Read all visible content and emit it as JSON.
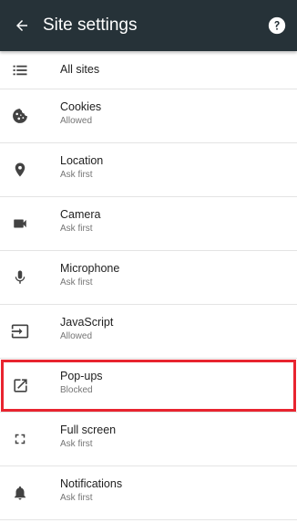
{
  "toolbar": {
    "title": "Site settings",
    "back_icon": "arrow-left-icon",
    "help_icon": "help-circle-icon",
    "background_color": "#263238"
  },
  "settings": [
    {
      "label": "All sites",
      "status": "",
      "icon": "list-icon"
    },
    {
      "label": "Cookies",
      "status": "Allowed",
      "icon": "cookie-icon"
    },
    {
      "label": "Location",
      "status": "Ask first",
      "icon": "location-pin-icon"
    },
    {
      "label": "Camera",
      "status": "Ask first",
      "icon": "video-camera-icon"
    },
    {
      "label": "Microphone",
      "status": "Ask first",
      "icon": "microphone-icon"
    },
    {
      "label": "JavaScript",
      "status": "Allowed",
      "icon": "javascript-input-icon"
    },
    {
      "label": "Pop-ups",
      "status": "Blocked",
      "icon": "open-in-new-icon"
    },
    {
      "label": "Full screen",
      "status": "Ask first",
      "icon": "fullscreen-icon"
    },
    {
      "label": "Notifications",
      "status": "Ask first",
      "icon": "bell-icon"
    }
  ],
  "highlight": {
    "item": "Pop-ups",
    "color": "#e8242f"
  }
}
